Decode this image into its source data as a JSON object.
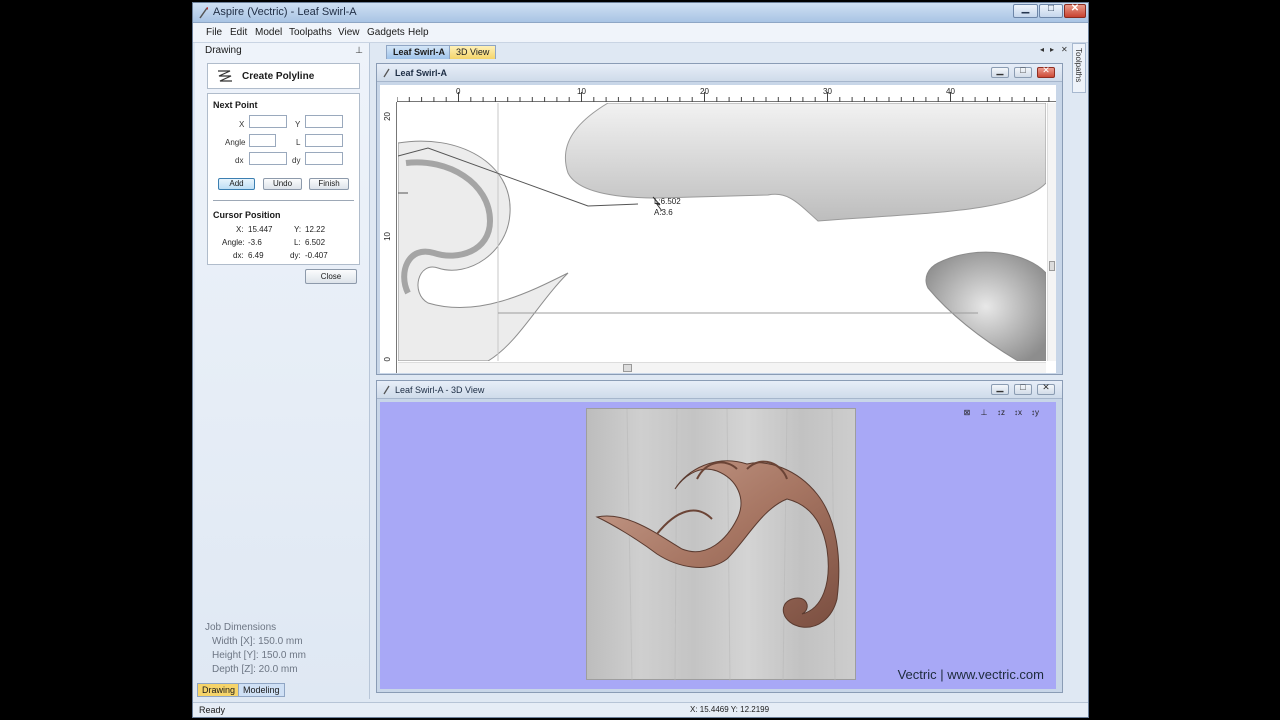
{
  "window": {
    "title": "Aspire (Vectric) - Leaf Swirl-A",
    "min": "▁",
    "max": "□",
    "close": "✕"
  },
  "menu": [
    "File",
    "Edit",
    "Model",
    "Toolpaths",
    "View",
    "Gadgets",
    "Help"
  ],
  "left_panel": {
    "header": "Drawing",
    "tool_label": "Create Polyline",
    "next_point": {
      "title": "Next Point",
      "x_label": "X",
      "x_value": "",
      "y_label": "Y",
      "y_value": "",
      "angle_label": "Angle",
      "angle_value": "",
      "l_label": "L",
      "l_value": "",
      "dx_label": "dx",
      "dx_value": "",
      "dy_label": "dy",
      "dy_value": ""
    },
    "buttons": {
      "add": "Add",
      "undo": "Undo",
      "finish": "Finish",
      "close": "Close"
    },
    "cursor": {
      "title": "Cursor Position",
      "x_label": "X:",
      "x": "15.447",
      "y_label": "Y:",
      "y": "12.22",
      "angle_label": "Angle:",
      "angle": "-3.6",
      "l_label": "L:",
      "l": "6.502",
      "dx_label": "dx:",
      "dx": "6.49",
      "dy_label": "dy:",
      "dy": "-0.407"
    },
    "job": {
      "title": "Job Dimensions",
      "width": "Width  [X]: 150.0 mm",
      "height": "Height [Y]: 150.0 mm",
      "depth": "Depth  [Z]: 20.0 mm"
    },
    "tabs": {
      "drawing": "Drawing",
      "modeling": "Modeling"
    }
  },
  "doc_tabs": {
    "t1": "Leaf Swirl-A",
    "t2": "3D View"
  },
  "drawing_pane": {
    "title": "Leaf Swirl-A",
    "ruler_h": [
      "0",
      "10",
      "20",
      "30",
      "40"
    ],
    "ruler_v": [
      "20",
      "10",
      "0"
    ],
    "readout_l": "L:6.502",
    "readout_a": "A:3.6"
  },
  "view_pane": {
    "title": "Leaf Swirl-A - 3D View",
    "brand": "Vectric | www.vectric.com",
    "icons": [
      "fit-icon",
      "iso-icon",
      "z-view-icon",
      "x-view-icon",
      "y-view-icon"
    ]
  },
  "side_tab": "Toolpaths",
  "status": {
    "ready": "Ready",
    "coords": "X: 15.4469 Y: 12.2199"
  }
}
